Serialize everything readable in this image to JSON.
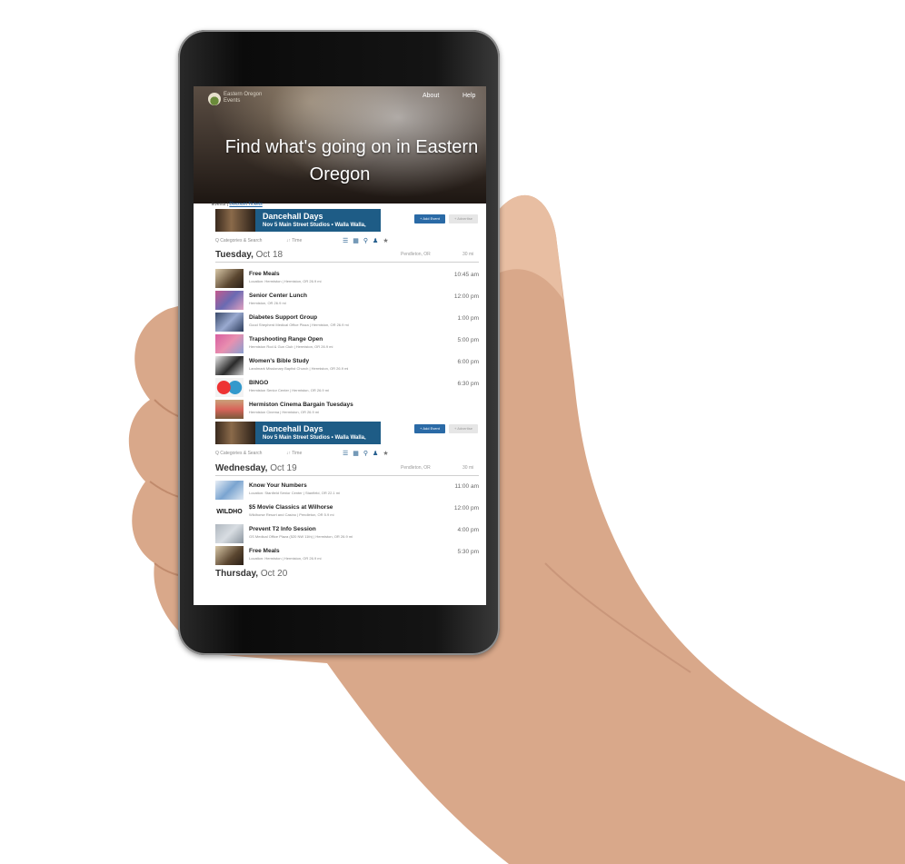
{
  "header": {
    "logo_line1": "Eastern Oregon",
    "logo_line2": "Events",
    "nav_about": "About",
    "nav_help": "Help",
    "hero_line1": "Find what's going on in Eastern",
    "hero_line2": "Oregon"
  },
  "breadcrumb": {
    "section": "Events",
    "separator": " | ",
    "link": "Discount Tickets"
  },
  "promo": {
    "title": "Dancehall Days",
    "subtitle": "Nov 5   Main Street Studios   • Walla Walla,",
    "add_event_label": "+ Add Event",
    "advertise_label": "+ Advertise"
  },
  "filters": {
    "categories_label": "Q Categories & Search",
    "time_label": "↓↑ Time"
  },
  "days": [
    {
      "name": "Tuesday,",
      "date": "Oct 18",
      "location": "Pendleton, OR",
      "distance": "30 mi"
    },
    {
      "name": "Wednesday,",
      "date": "Oct 19",
      "location": "Pendleton, OR",
      "distance": "30 mi"
    },
    {
      "name": "Thursday,",
      "date": "Oct 20"
    }
  ],
  "tuesday_events": [
    {
      "title": "Free Meals",
      "sub": "Location: Hermiston | Hermiston, OR   26.9 mi",
      "time": "10:45 am"
    },
    {
      "title": "Senior Center Lunch",
      "sub": "Hermiston, OR   26.9 mi",
      "time": "12:00 pm"
    },
    {
      "title": "Diabetes Support Group",
      "sub": "Good Shepherd Medical Office Plaza | Hermiston, OR   26.9 mi",
      "time": "1:00 pm"
    },
    {
      "title": "Trapshooting Range Open",
      "sub": "Hermiston Rod & Gun Club | Hermiston, OR   26.9 mi",
      "time": "5:00 pm"
    },
    {
      "title": "Women's Bible Study",
      "sub": "Landmark Missionary Baptist Church | Hermiston, OR   26.9 mi",
      "time": "6:00 pm"
    },
    {
      "title": "BINGO",
      "sub": "Hermiston Senior Center | Hermiston, OR   26.9 mi",
      "time": "6:30 pm"
    },
    {
      "title": "Hermiston Cinema Bargain Tuesdays",
      "sub": "Hermiston Cinema | Hermiston, OR   26.9 mi",
      "time": ""
    }
  ],
  "wednesday_events": [
    {
      "title": "Know Your Numbers",
      "sub": "Location: Stanfield Senior Center | Stanfield, OR   22.1 mi",
      "time": "11:00 am"
    },
    {
      "title": "$5 Movie Classics at Wilhorse",
      "sub": "Wildhorse Resort and Casino | Pendleton, OR   5.9 mi",
      "time": "12:00 pm",
      "thumb_text": "WILDHO"
    },
    {
      "title": "Prevent T2 Info Session",
      "sub": "GS Medical Office Plaza (520 NW 11th) | Hermiston, OR   26.9 mi",
      "time": "4:00 pm"
    },
    {
      "title": "Free Meals",
      "sub": "Location: Hermiston | Hermiston, OR   26.9 mi",
      "time": "5:30 pm"
    }
  ]
}
